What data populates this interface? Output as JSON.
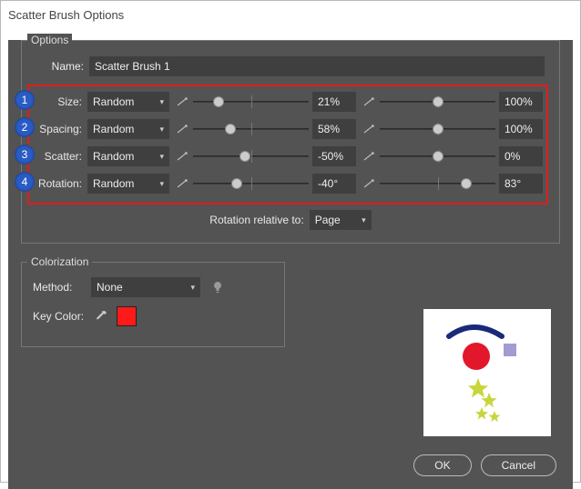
{
  "window": {
    "title": "Scatter Brush Options"
  },
  "options": {
    "group_label": "Options",
    "name_label": "Name:",
    "name_value": "Scatter Brush 1",
    "rows": [
      {
        "label": "Size:",
        "mode": "Random",
        "val1": "21%",
        "val2": "100%",
        "thumb1_pct": 22,
        "thumb2_pct": 50
      },
      {
        "label": "Spacing:",
        "mode": "Random",
        "val1": "58%",
        "val2": "100%",
        "thumb1_pct": 32,
        "thumb2_pct": 50
      },
      {
        "label": "Scatter:",
        "mode": "Random",
        "val1": "-50%",
        "val2": "0%",
        "thumb1_pct": 45,
        "thumb2_pct": 50
      },
      {
        "label": "Rotation:",
        "mode": "Random",
        "val1": "-40°",
        "val2": "83°",
        "thumb1_pct": 38,
        "thumb2_pct": 75
      }
    ],
    "relative_label": "Rotation relative to:",
    "relative_value": "Page"
  },
  "badges": [
    "1",
    "2",
    "3",
    "4"
  ],
  "colorization": {
    "group_label": "Colorization",
    "method_label": "Method:",
    "method_value": "None",
    "key_label": "Key Color:",
    "swatch_hex": "#ff1a1a"
  },
  "footer": {
    "ok": "OK",
    "cancel": "Cancel"
  }
}
